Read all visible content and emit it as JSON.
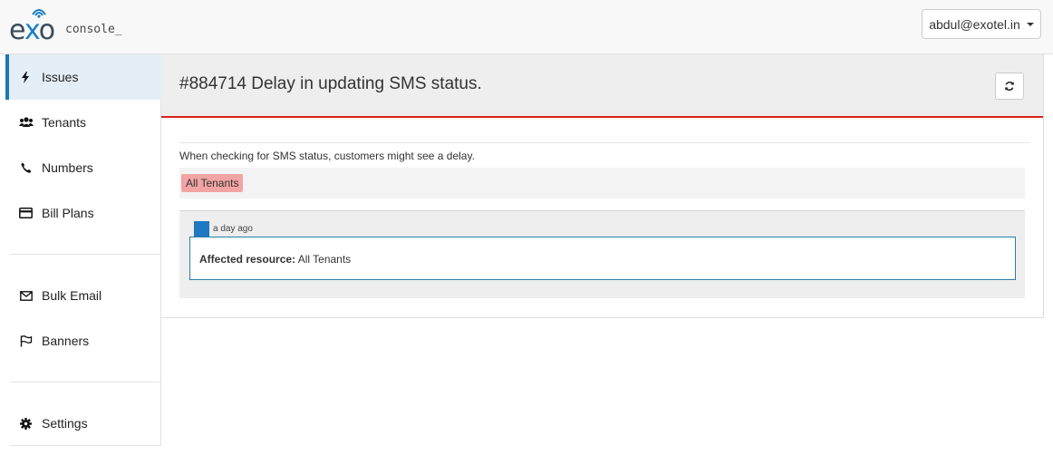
{
  "header": {
    "logo_text": "exo",
    "logo_suffix": "console_",
    "user_menu": "abdul@exotel.in"
  },
  "sidebar": {
    "items": [
      {
        "label": "Issues",
        "icon": "bolt-icon",
        "active": true
      },
      {
        "label": "Tenants",
        "icon": "users-icon"
      },
      {
        "label": "Numbers",
        "icon": "phone-icon"
      },
      {
        "label": "Bill Plans",
        "icon": "credit-card-icon"
      },
      {
        "label": "Bulk Email",
        "icon": "envelope-icon"
      },
      {
        "label": "Banners",
        "icon": "flag-icon"
      },
      {
        "label": "Settings",
        "icon": "gear-icon"
      }
    ]
  },
  "issue": {
    "title": "#884714 Delay in updating SMS status.",
    "description": "When checking for SMS status, customers might see a delay.",
    "tag": "All Tenants",
    "update": {
      "time": "a day ago",
      "label": "Affected resource:",
      "value": "All Tenants"
    }
  },
  "colors": {
    "accent": "#1f77b4",
    "alert_border": "#d9221b",
    "tag_bg": "#f2a3a3"
  }
}
